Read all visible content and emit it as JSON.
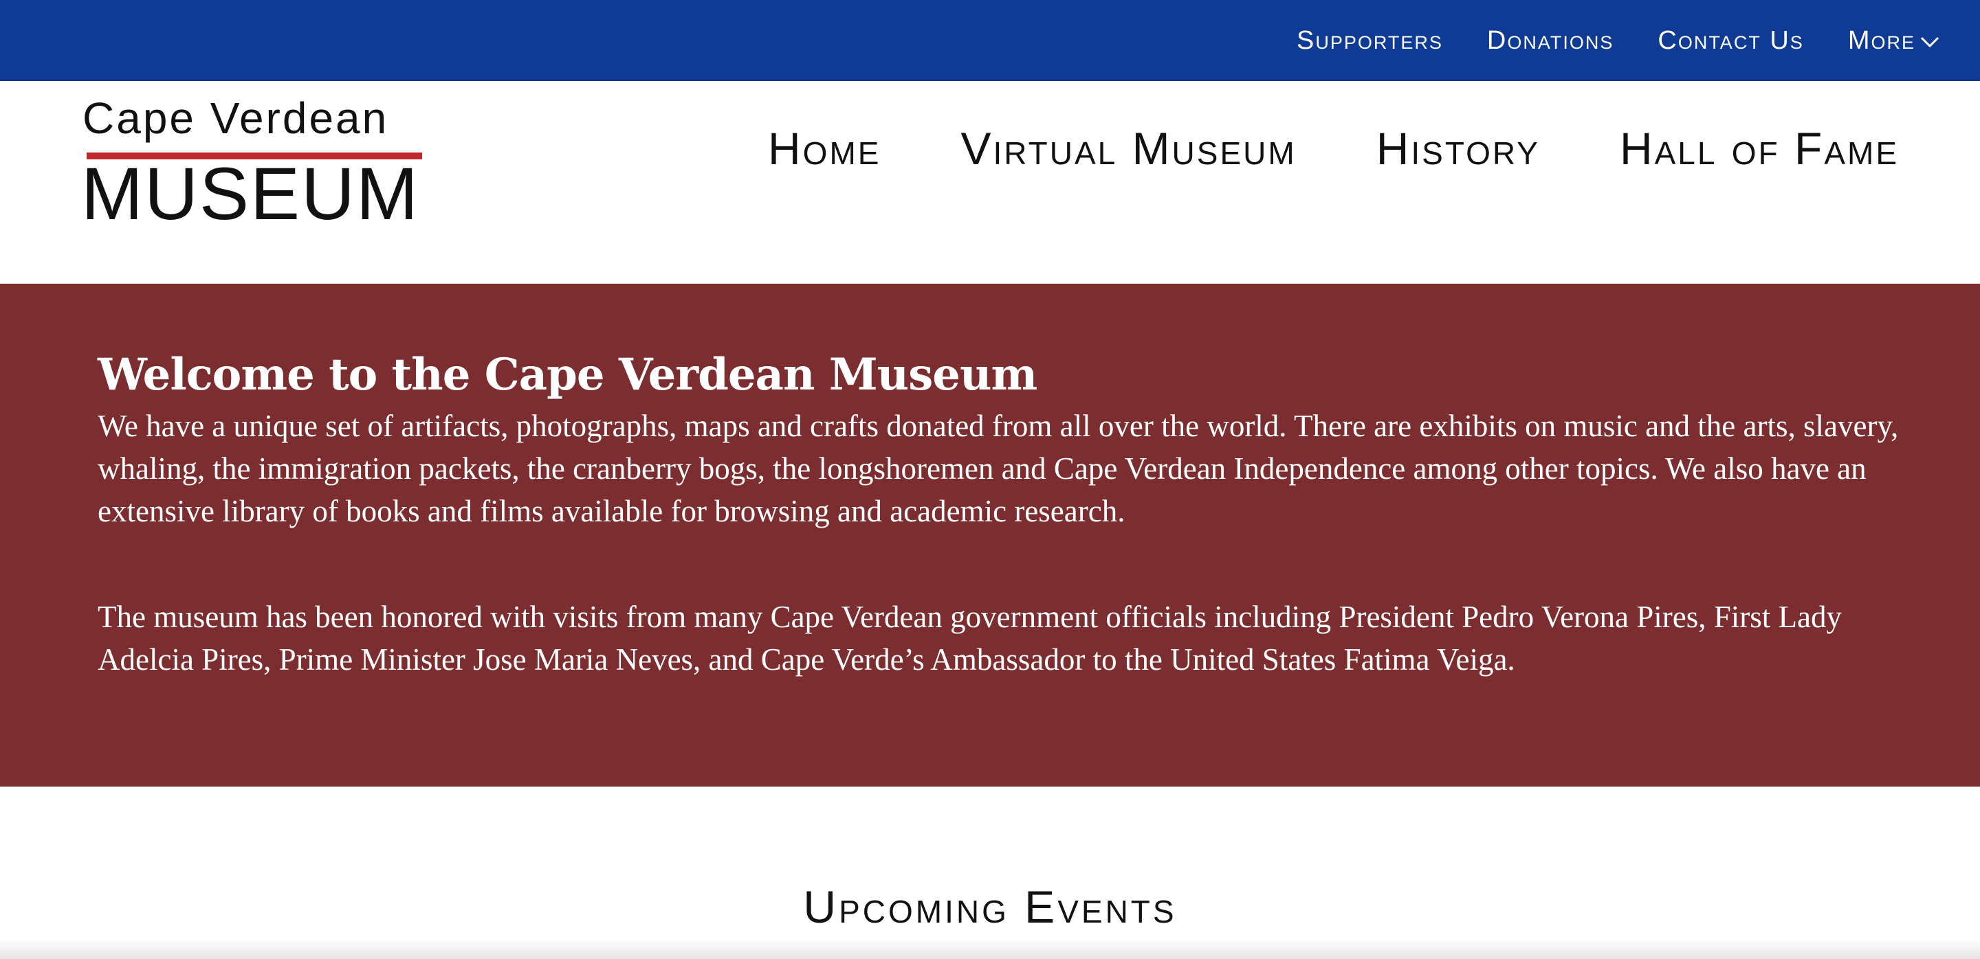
{
  "colors": {
    "topbar": "#0f3b94",
    "hero_background": "#7c2d2f",
    "logo_accent": "#c0262d",
    "text_dark": "#111111",
    "text_light": "#ffffff"
  },
  "topnav": {
    "items": [
      {
        "label": "Supporters"
      },
      {
        "label": "Donations"
      },
      {
        "label": "Contact Us"
      },
      {
        "label": "More",
        "icon": "chevron-down-icon"
      }
    ]
  },
  "logo": {
    "line1": "Cape Verdean",
    "line2": "MUSEUM"
  },
  "mainnav": {
    "items": [
      {
        "label": "Home"
      },
      {
        "label": "Virtual Museum"
      },
      {
        "label": "History"
      },
      {
        "label": "Hall of Fame"
      }
    ]
  },
  "hero": {
    "title": "Welcome to the Cape Verdean Museum",
    "paragraph1": "We have a unique set of artifacts, photographs, maps and crafts donated from all over the world. There are exhibits on music and the arts, slavery, whaling, the immigration packets, the cranberry bogs, the longshoremen and Cape Verdean Independence among other topics. We also have an extensive library of books and films available for browsing and academic research.",
    "paragraph2": "The museum has been honored with visits from many Cape Verdean government officials including President Pedro Verona Pires, First Lady Adelcia Pires, Prime Minister Jose Maria Neves, and Cape Verde’s Ambassador to the United States Fatima Veiga."
  },
  "events": {
    "heading": "Upcoming Events"
  }
}
